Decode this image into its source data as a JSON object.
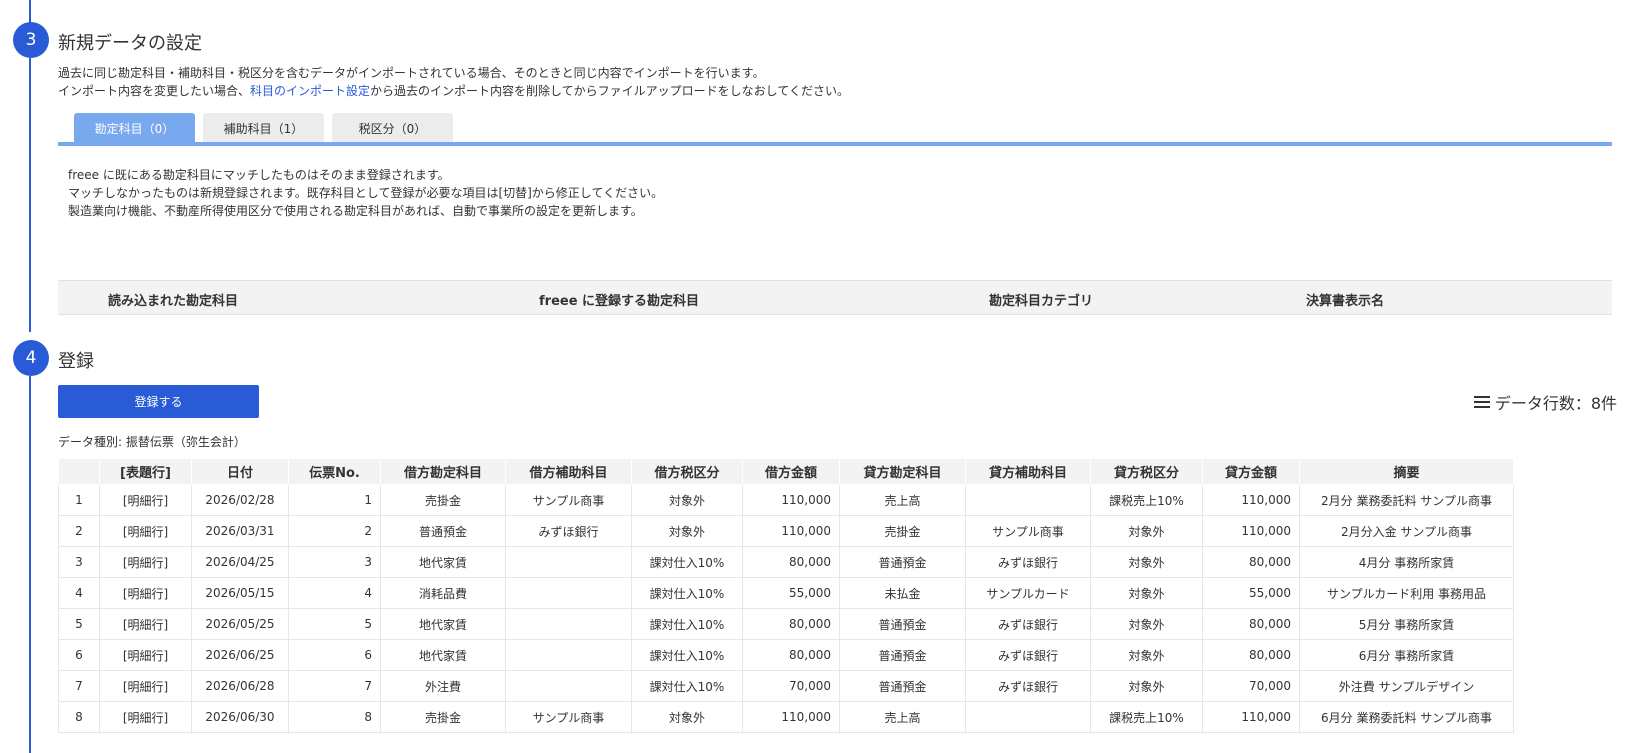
{
  "step3": {
    "number": "3",
    "title": "新規データの設定",
    "desc_line1": "過去に同じ勘定科目・補助科目・税区分を含むデータがインポートされている場合、そのときと同じ内容でインポートを行います。",
    "desc_line2_pre": "インポート内容を変更したい場合、",
    "desc_link": "科目のインポート設定",
    "desc_line2_post": "から過去のインポート内容を削除してからファイルアップロードをしなおしてください。",
    "tabs": [
      {
        "label": "勘定科目（0）",
        "active": true
      },
      {
        "label": "補助科目（1）",
        "active": false
      },
      {
        "label": "税区分（0）",
        "active": false
      }
    ],
    "info_lines": [
      "freee に既にある勘定科目にマッチしたものはそのまま登録されます。",
      "マッチしなかったものは新規登録されます。既存科目として登録が必要な項目は[切替]から修正してください。",
      "製造業向け機能、不動産所得使用区分で使用される勘定科目があれば、自動で事業所の設定を更新します。"
    ],
    "account_columns": [
      "読み込まれた勘定科目",
      "freee に登録する勘定科目",
      "勘定科目カテゴリ",
      "決算書表示名"
    ]
  },
  "step4": {
    "number": "4",
    "title": "登録",
    "register_button": "登録する",
    "row_count": "データ行数：8件",
    "data_type": "データ種別: 振替伝票（弥生会計）",
    "columns": [
      "",
      "[表題行]",
      "日付",
      "伝票No.",
      "借方勘定科目",
      "借方補助科目",
      "借方税区分",
      "借方金額",
      "貸方勘定科目",
      "貸方補助科目",
      "貸方税区分",
      "貸方金額",
      "摘要"
    ],
    "rows": [
      [
        "1",
        "[明細行]",
        "2026/02/28",
        "1",
        "売掛金",
        "サンプル商事",
        "対象外",
        "110,000",
        "売上高",
        "",
        "課税売上10%",
        "110,000",
        "2月分 業務委託料 サンプル商事"
      ],
      [
        "2",
        "[明細行]",
        "2026/03/31",
        "2",
        "普通預金",
        "みずほ銀行",
        "対象外",
        "110,000",
        "売掛金",
        "サンプル商事",
        "対象外",
        "110,000",
        "2月分入金 サンプル商事"
      ],
      [
        "3",
        "[明細行]",
        "2026/04/25",
        "3",
        "地代家賃",
        "",
        "課対仕入10%",
        "80,000",
        "普通預金",
        "みずほ銀行",
        "対象外",
        "80,000",
        "4月分 事務所家賃"
      ],
      [
        "4",
        "[明細行]",
        "2026/05/15",
        "4",
        "消耗品費",
        "",
        "課対仕入10%",
        "55,000",
        "未払金",
        "サンプルカード",
        "対象外",
        "55,000",
        "サンプルカード利用 事務用品"
      ],
      [
        "5",
        "[明細行]",
        "2026/05/25",
        "5",
        "地代家賃",
        "",
        "課対仕入10%",
        "80,000",
        "普通預金",
        "みずほ銀行",
        "対象外",
        "80,000",
        "5月分 事務所家賃"
      ],
      [
        "6",
        "[明細行]",
        "2026/06/25",
        "6",
        "地代家賃",
        "",
        "課対仕入10%",
        "80,000",
        "普通預金",
        "みずほ銀行",
        "対象外",
        "80,000",
        "6月分 事務所家賃"
      ],
      [
        "7",
        "[明細行]",
        "2026/06/28",
        "7",
        "外注費",
        "",
        "課対仕入10%",
        "70,000",
        "普通預金",
        "みずほ銀行",
        "対象外",
        "70,000",
        "外注費 サンプルデザイン"
      ],
      [
        "8",
        "[明細行]",
        "2026/06/30",
        "8",
        "売掛金",
        "サンプル商事",
        "対象外",
        "110,000",
        "売上高",
        "",
        "課税売上10%",
        "110,000",
        "6月分 業務委託料 サンプル商事"
      ]
    ]
  }
}
